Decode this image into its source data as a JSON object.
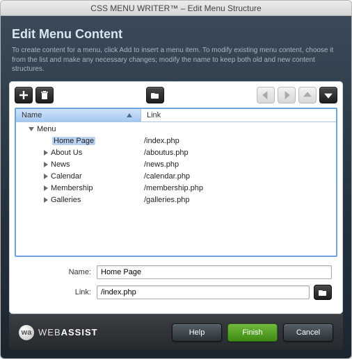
{
  "window": {
    "title": "CSS MENU WRITER™ – Edit Menu Structure"
  },
  "header": {
    "title": "Edit Menu Content",
    "description": "To create content for a menu, click Add to insert a menu item. To modify existing menu content, choose it from the list and make any necessary changes; modify the name to keep both old and new content structures."
  },
  "columns": {
    "name": "Name",
    "link": "Link"
  },
  "tree": [
    {
      "level": 1,
      "disclosure": "down",
      "name": "Menu",
      "link": "",
      "selected": false
    },
    {
      "level": 2,
      "disclosure": "none",
      "name": "Home Page",
      "link": "/index.php",
      "selected": true
    },
    {
      "level": 2,
      "disclosure": "right",
      "name": "About Us",
      "link": "/aboutus.php",
      "selected": false
    },
    {
      "level": 2,
      "disclosure": "right",
      "name": "News",
      "link": "/news.php",
      "selected": false
    },
    {
      "level": 2,
      "disclosure": "right",
      "name": "Calendar",
      "link": "/calendar.php",
      "selected": false
    },
    {
      "level": 2,
      "disclosure": "right",
      "name": "Membership",
      "link": "/membership.php",
      "selected": false
    },
    {
      "level": 2,
      "disclosure": "right",
      "name": "Galleries",
      "link": "/galleries.php",
      "selected": false
    }
  ],
  "form": {
    "name_label": "Name:",
    "name_value": "Home Page",
    "link_label": "Link:",
    "link_value": "/index.php"
  },
  "footer": {
    "brand_thin": "WEB",
    "brand_bold": "ASSIST",
    "help": "Help",
    "finish": "Finish",
    "cancel": "Cancel"
  }
}
